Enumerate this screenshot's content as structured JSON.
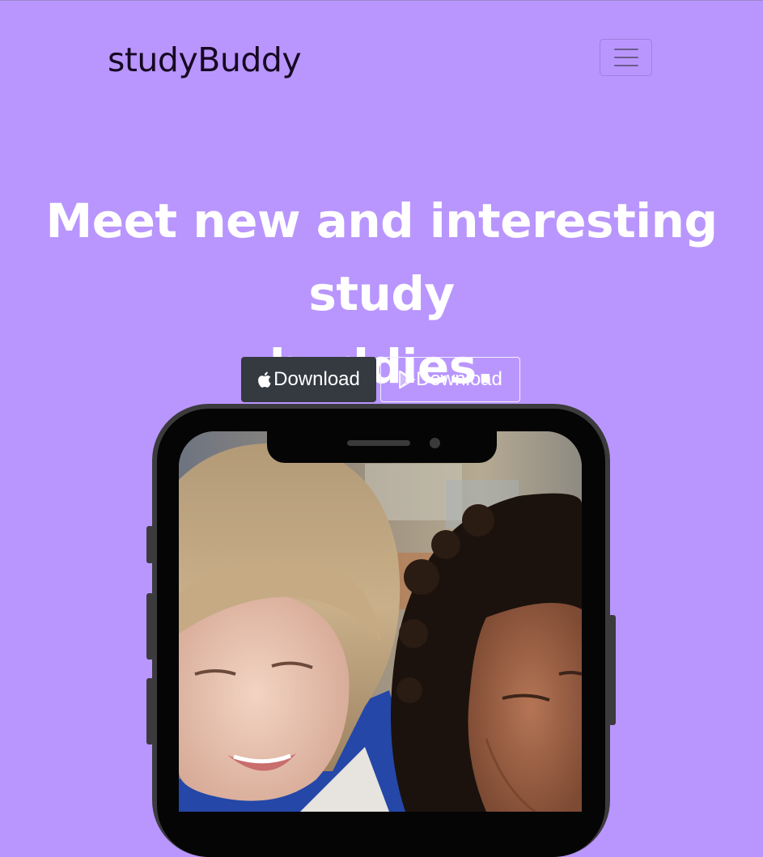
{
  "navbar": {
    "brand": "studyBuddy",
    "toggle_icon": "hamburger-menu-icon"
  },
  "hero": {
    "headline_line1": "Meet new and interesting study",
    "headline_line2": "buddies.",
    "apple_button": {
      "label": "Download",
      "icon": "apple-icon"
    },
    "play_button": {
      "label": "Download",
      "icon": "google-play-icon"
    }
  },
  "colors": {
    "background": "#b996fe",
    "brand_text": "#160822",
    "dark_button": "#343a40",
    "headline": "#ffffff"
  }
}
